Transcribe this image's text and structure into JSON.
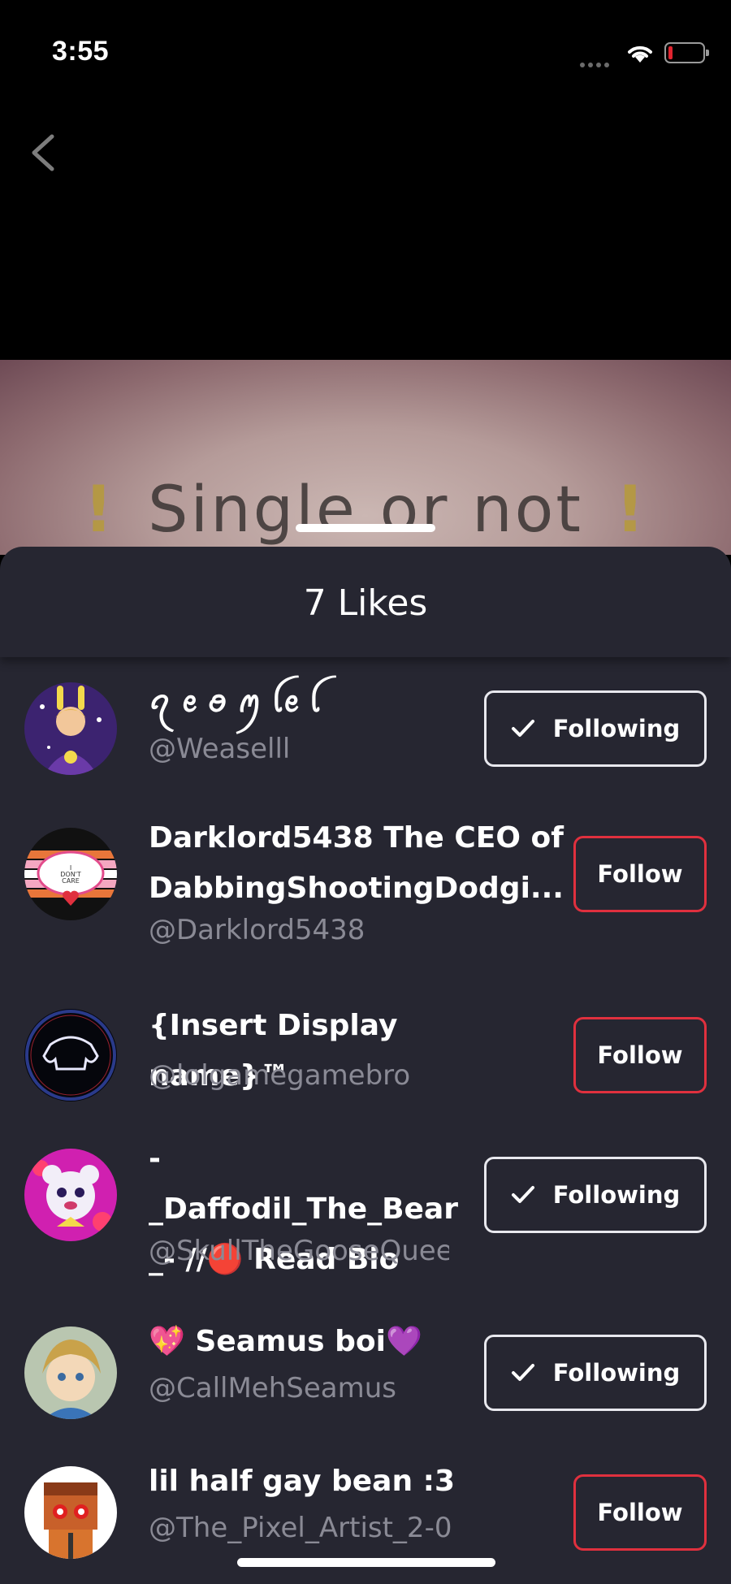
{
  "status_bar": {
    "time": "3:55"
  },
  "video": {
    "overlay_text": "Single or not",
    "warn_glyph": "!"
  },
  "sheet": {
    "title": "7 Likes",
    "users": [
      {
        "name": "ꪖ ꫀ ꪮ ꪑ ꪶꫀ ꪶ",
        "handle": "@Weaselll",
        "button": "Following",
        "following": true
      },
      {
        "name": "Darklord5438 The CEO of\nDabbingShootingDodgi...",
        "handle": "@Darklord5438",
        "button": "Follow",
        "following": false
      },
      {
        "name": "{Insert Display name}™",
        "handle": "@lolgamegamebro",
        "button": "Follow",
        "following": false
      },
      {
        "name": "-_Daffodil_The_Bear\n_-  //🔴 Read Bio",
        "handle": "@SkullTheGooseQuee",
        "button": "Following",
        "following": true
      },
      {
        "name": "💖 Seamus boi💜",
        "handle": "@CallMehSeamus",
        "button": "Following",
        "following": true
      },
      {
        "name": "lil half gay bean :3",
        "handle": "@The_Pixel_Artist_2-0",
        "button": "Follow",
        "following": false
      }
    ]
  },
  "colors": {
    "sheet_bg": "#262631",
    "follow_border": "#e0303e",
    "handle_text": "#8a8a95"
  }
}
